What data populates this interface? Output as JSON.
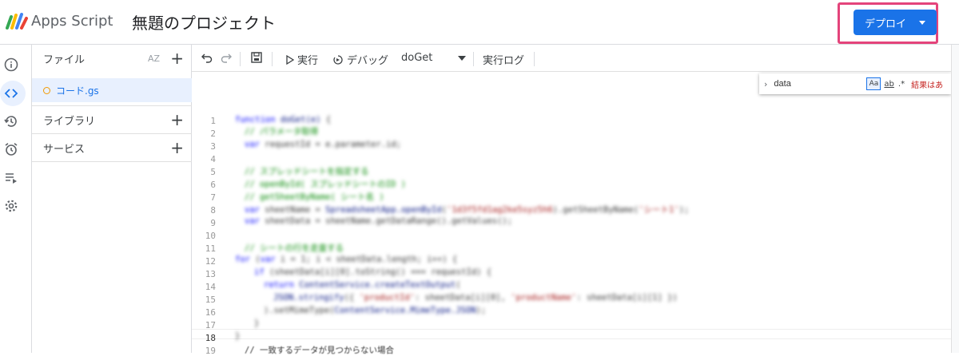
{
  "header": {
    "app_name": "Apps Script",
    "project_title": "無題のプロジェクト",
    "deploy_label": "デプロイ"
  },
  "rail": {
    "icons": [
      "info-icon",
      "code-icon",
      "history-icon",
      "alarm-icon",
      "playlist-icon",
      "settings-icon"
    ]
  },
  "files": {
    "header": "ファイル",
    "sort_label": "AZ",
    "items": [
      {
        "name": "コード.gs"
      }
    ],
    "libraries_label": "ライブラリ",
    "services_label": "サービス"
  },
  "toolbar": {
    "run_label": "実行",
    "debug_label": "デバッグ",
    "function_selected": "doGet",
    "log_label": "実行ログ"
  },
  "find": {
    "query": "data",
    "match_case": "Aa",
    "whole_word": "ab",
    "regex": ".*",
    "result_text": "結果はあ"
  },
  "editor": {
    "line_numbers": [
      "1",
      "2",
      "3",
      "4",
      "5",
      "6",
      "7",
      "8",
      "9",
      "10",
      "11",
      "12",
      "13",
      "14",
      "15",
      "16",
      "17",
      "18",
      "19"
    ],
    "visible_comment": "// 一致するデータが見つからない場合"
  },
  "colors": {
    "accent": "#1a73e8",
    "highlight_frame": "#e4447b"
  }
}
